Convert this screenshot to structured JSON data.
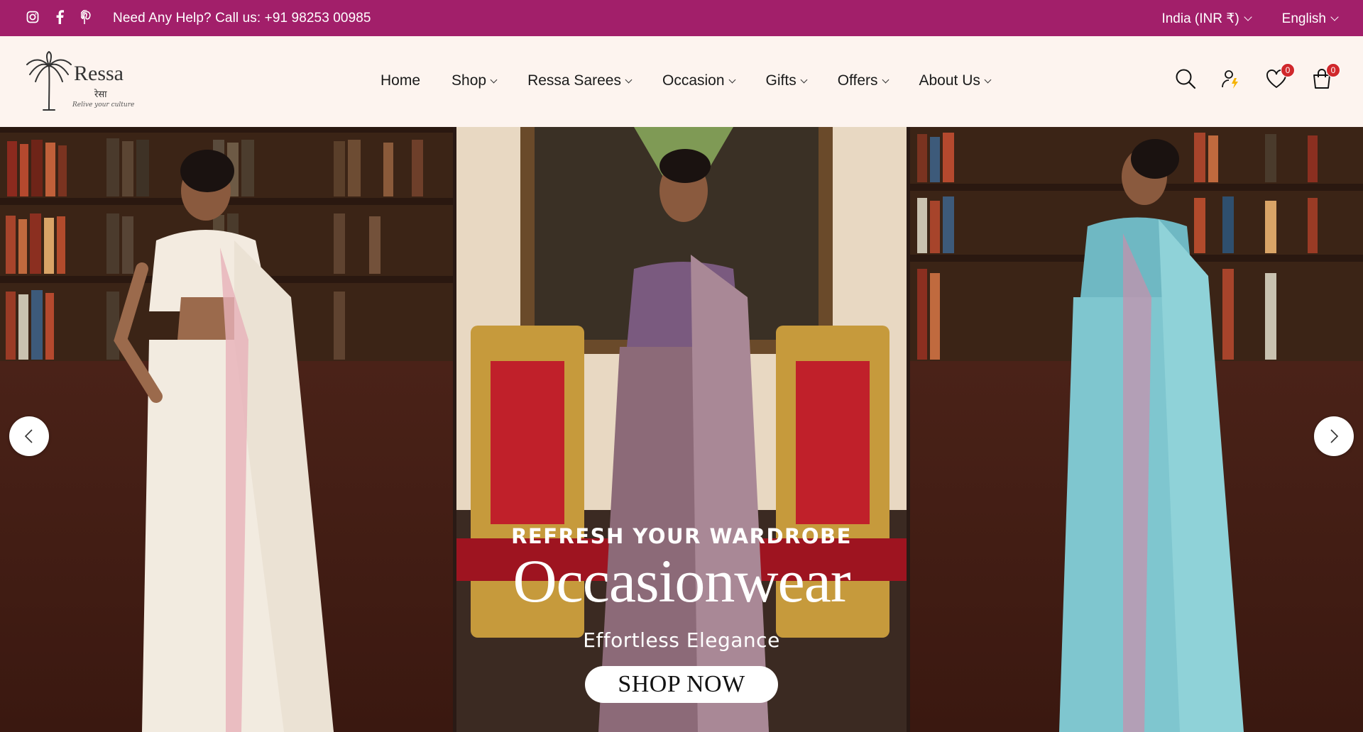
{
  "topbar": {
    "social_icons": [
      "instagram-icon",
      "facebook-icon",
      "pinterest-icon"
    ],
    "help_text": "Need Any Help? Call us: +91 98253 00985",
    "currency": "India (INR ₹)",
    "language": "English",
    "bg_color": "#a21f6a"
  },
  "header": {
    "logo": {
      "word": "Ressa",
      "hindi": "रेसा",
      "tagline": "Relive your culture"
    },
    "nav": [
      {
        "label": "Home",
        "dropdown": false
      },
      {
        "label": "Shop",
        "dropdown": true
      },
      {
        "label": "Ressa Sarees",
        "dropdown": true
      },
      {
        "label": "Occasion",
        "dropdown": true
      },
      {
        "label": "Gifts",
        "dropdown": true
      },
      {
        "label": "Offers",
        "dropdown": true
      },
      {
        "label": "About Us",
        "dropdown": true
      }
    ],
    "icons": {
      "search": "search-icon",
      "account": "account-icon",
      "wishlist": "heart-icon",
      "wishlist_count": "0",
      "cart": "cart-icon",
      "cart_count": "0"
    }
  },
  "hero": {
    "kicker": "REFRESH YOUR WARDROBE",
    "title": "Occasionwear",
    "subtitle": "Effortless Elegance",
    "cta": "SHOP NOW"
  }
}
